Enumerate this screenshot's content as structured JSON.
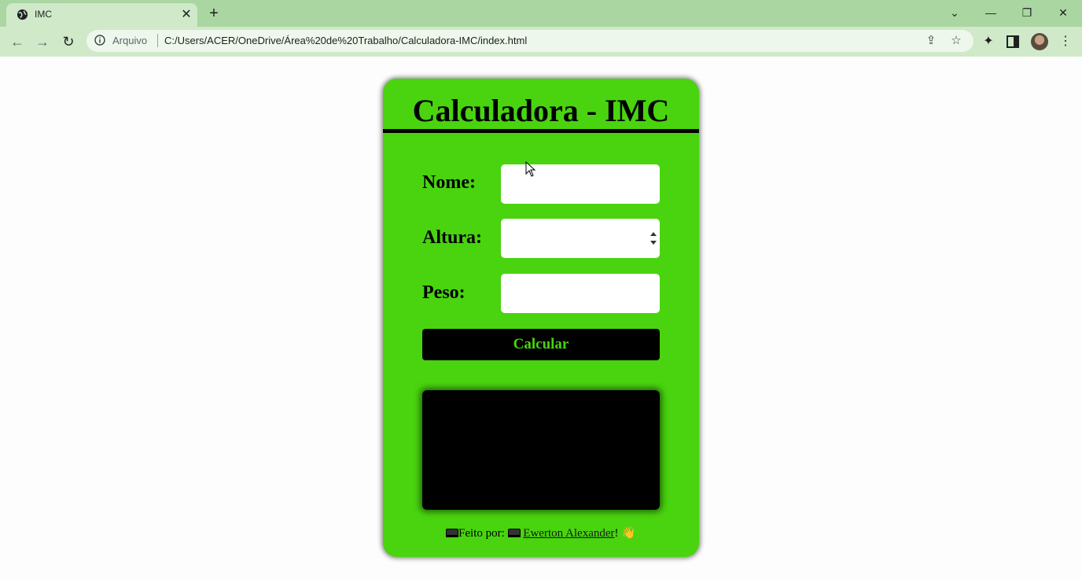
{
  "browser": {
    "tab": {
      "title": "IMC",
      "favicon": "globe-icon",
      "close": "✕"
    },
    "new_tab": "+",
    "window_controls": {
      "tabsearch": "⌄",
      "minimize": "—",
      "restore": "❐",
      "close": "✕"
    },
    "nav": {
      "back": "←",
      "forward": "→",
      "reload": "↻"
    },
    "omnibox": {
      "scheme_label": "Arquivo",
      "url": "C:/Users/ACER/OneDrive/Área%20de%20Trabalho/Calculadora-IMC/index.html"
    },
    "icons": [
      "share-icon",
      "star-icon",
      "extensions-icon",
      "side-panel-icon",
      "avatar",
      "menu-icon"
    ]
  },
  "app": {
    "title": "Calculadora - IMC",
    "fields": {
      "nome": {
        "label": "Nome:",
        "value": ""
      },
      "altura": {
        "label": "Altura:",
        "value": ""
      },
      "peso": {
        "label": "Peso:",
        "value": ""
      }
    },
    "button_label": "Calcular",
    "result_text": "",
    "footer": {
      "prefix": "Feito por:",
      "author": "Ewerton Alexander",
      "suffix": "!",
      "wave": "👋"
    }
  },
  "colors": {
    "card": "#49d40f",
    "button_bg": "#000000",
    "button_text": "#49d40f",
    "chrome": "#a9d6a1",
    "toolbar": "#cfe9c9"
  }
}
